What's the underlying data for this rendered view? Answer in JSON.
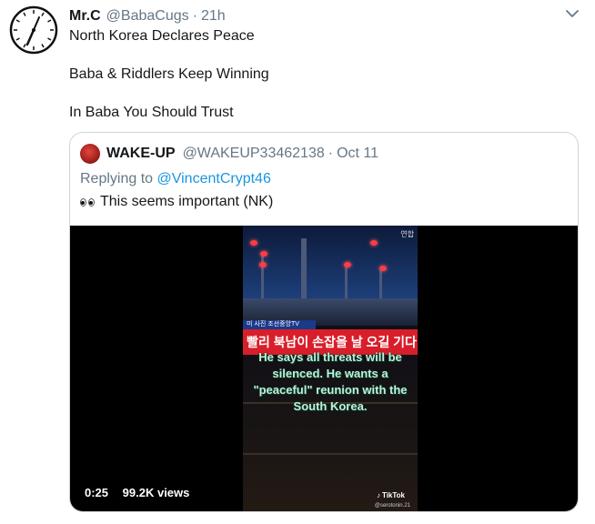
{
  "tweet": {
    "display_name": "Mr.C",
    "handle": "@BabaCugs",
    "separator": "·",
    "time": "21h",
    "lines": [
      "North Korea Declares Peace",
      "Baba & Riddlers Keep Winning",
      "In Baba You Should Trust"
    ],
    "avatar_icon": "clock-icon",
    "menu_icon": "chevron-down-icon"
  },
  "quoted": {
    "display_name": "WAKE-UP",
    "handle": "@WAKEUP33462138",
    "separator": "·",
    "date": "Oct 11",
    "replying_prefix": "Replying to",
    "replying_to": "@VincentCrypt46",
    "text": "This seems important (NK)",
    "emoji_icon": "eyes-emoji-icon"
  },
  "video": {
    "duration": "0:25",
    "views": "99.2K views",
    "news_label": "미 사진 조선중앙TV",
    "news_headline": "빨리 북남이 손잡을 날 오길 기다",
    "corner_tag": "연합",
    "caption": "He says all threats will be silenced. He wants a \"peaceful\" reunion with the South Korea.",
    "watermark": "TikTok",
    "watermark_user": "@serotonin.21"
  },
  "colors": {
    "link": "#1b95e0",
    "secondary_text": "#657786",
    "border": "#ccd6dd",
    "news_red": "#d81e2a"
  }
}
